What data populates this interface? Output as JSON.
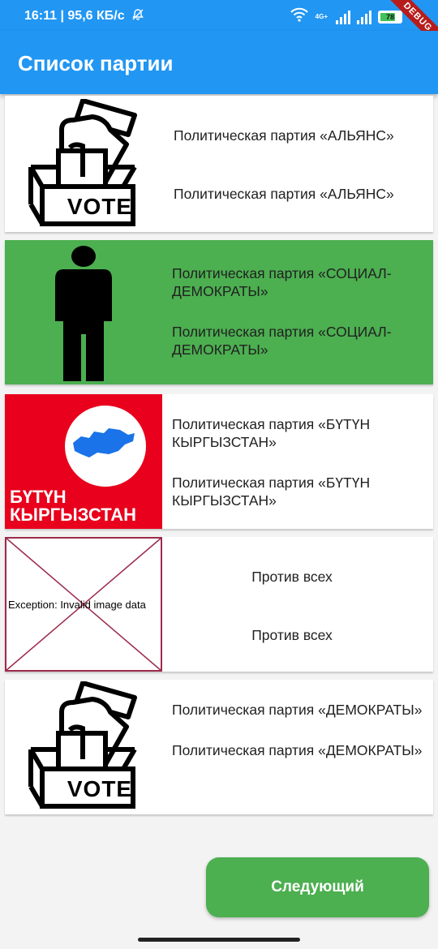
{
  "status_bar": {
    "time_speed": "16:11 | 95,6 КБ/с",
    "network": "4G+",
    "battery": "78",
    "debug_banner": "DEBUG"
  },
  "appbar": {
    "title": "Список партии"
  },
  "parties": [
    {
      "name": "Политическая партия «АЛЬЯНС»",
      "subtitle": "Политическая партия «АЛЬЯНС»",
      "image": "vote-ballot-box-icon",
      "logo_text": "VOTE"
    },
    {
      "name": "Политическая партия «СОЦИАЛ-ДЕМОКРАТЫ»",
      "subtitle": "Политическая партия «СОЦИАЛ-ДЕМОКРАТЫ»",
      "image": "person-silhouette-icon",
      "card_color": "#4caf50"
    },
    {
      "name": "Политическая партия «БҮТҮН КЫРГЫЗСТАН»",
      "subtitle": "Политическая партия «БҮТҮН КЫРГЫЗСТАН»",
      "image": "butun-kyrgyzstan-logo",
      "logo_line1": "БҮТҮН",
      "logo_line2": "КЫРГЫЗСТАН"
    },
    {
      "name": "Против всех",
      "subtitle": "Против всех",
      "image": "broken-image-placeholder",
      "error_text": "Exception: Invalid image data"
    },
    {
      "name": "Политическая партия «ДЕМОКРАТЫ»",
      "subtitle": "Политическая партия «ДЕМОКРАТЫ»",
      "image": "vote-ballot-box-icon",
      "logo_text": "VOTE"
    }
  ],
  "next_button": {
    "label": "Следующий",
    "color": "#4caf50"
  },
  "colors": {
    "primary": "#2196f3",
    "accent": "#4caf50",
    "logo_red": "#e8001c",
    "error_border": "#9c2c4c"
  }
}
